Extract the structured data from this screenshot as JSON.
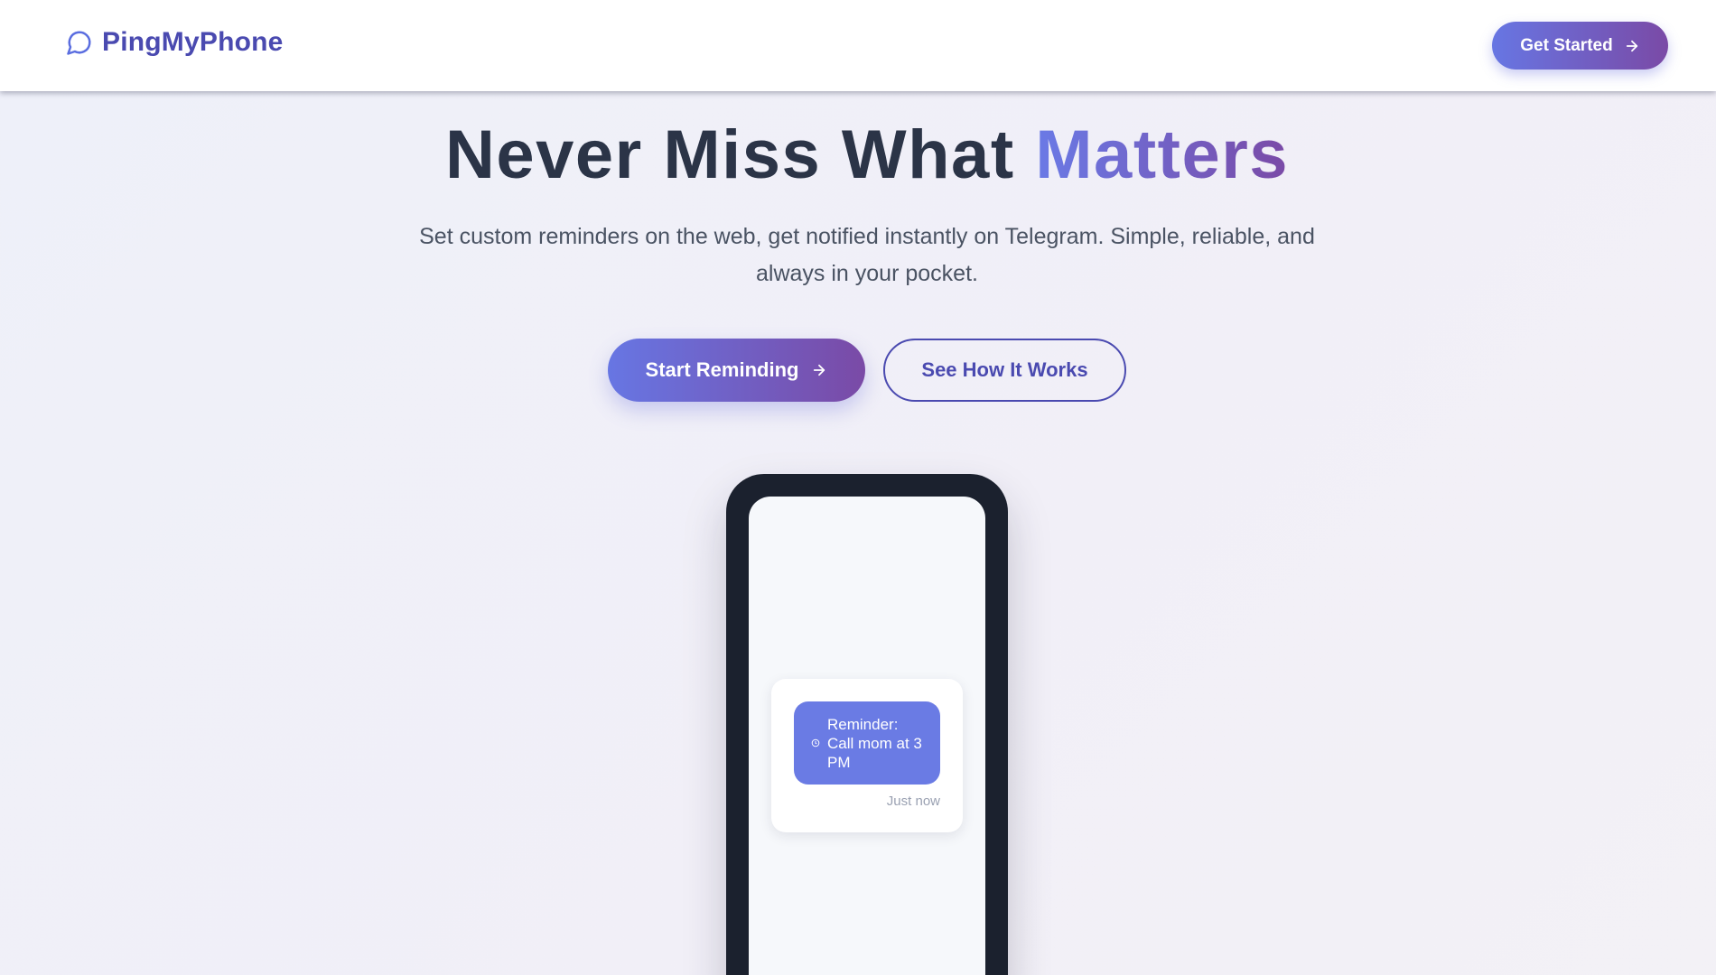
{
  "app": {
    "name": "PingMyPhone",
    "logo_icon": "chat-bubble-icon"
  },
  "nav": {
    "cta_label": "Get Started",
    "cta_icon": "arrow-right-icon"
  },
  "hero": {
    "title_main": "Never Miss What",
    "title_accent": "Matters",
    "subtitle": "Set custom reminders on the web, get notified instantly on Telegram. Simple, reliable, and always in your pocket.",
    "primary_cta": "Start Reminding",
    "primary_cta_icon": "arrow-right-icon",
    "secondary_cta": "See How It Works"
  },
  "phone_mockup": {
    "notification": {
      "icon": "clock-icon",
      "message": "Reminder: Call mom at 3 PM",
      "time": "Just now"
    }
  },
  "colors": {
    "brand": "#4a4ab0",
    "gradient_start": "#6776e3",
    "gradient_end": "#7a4aa6",
    "heading": "#2b3447",
    "body_text": "#4a5363",
    "phone_frame": "#1b212e",
    "bubble": "#6a7be4"
  }
}
